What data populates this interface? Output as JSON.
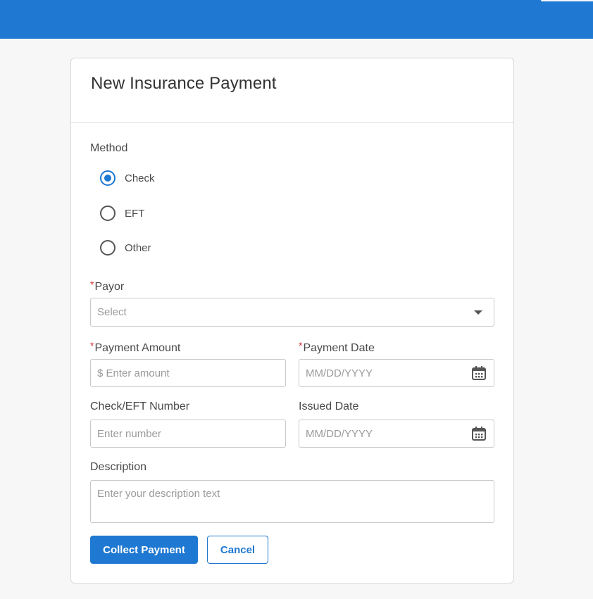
{
  "colors": {
    "topbar": "#1f78d1",
    "accent": "#1f78d1",
    "required": "#d0312d"
  },
  "card": {
    "title": "New Insurance Payment"
  },
  "method": {
    "label": "Method",
    "options": [
      {
        "label": "Check",
        "selected": true
      },
      {
        "label": "EFT",
        "selected": false
      },
      {
        "label": "Other",
        "selected": false
      }
    ]
  },
  "payor": {
    "required_mark": "*",
    "label": "Payor",
    "value": "Select",
    "icon": "chevron-down-icon"
  },
  "payment_amount": {
    "required_mark": "*",
    "label": "Payment Amount",
    "placeholder": "$ Enter amount"
  },
  "payment_date": {
    "required_mark": "*",
    "label": "Payment Date",
    "placeholder": "MM/DD/YYYY",
    "icon": "calendar-icon"
  },
  "check_number": {
    "label": "Check/EFT Number",
    "placeholder": "Enter number"
  },
  "issued_date": {
    "label": "Issued Date",
    "placeholder": "MM/DD/YYYY",
    "icon": "calendar-icon"
  },
  "description": {
    "label": "Description",
    "placeholder": "Enter your description text"
  },
  "actions": {
    "collect_label": "Collect Payment",
    "cancel_label": "Cancel"
  }
}
